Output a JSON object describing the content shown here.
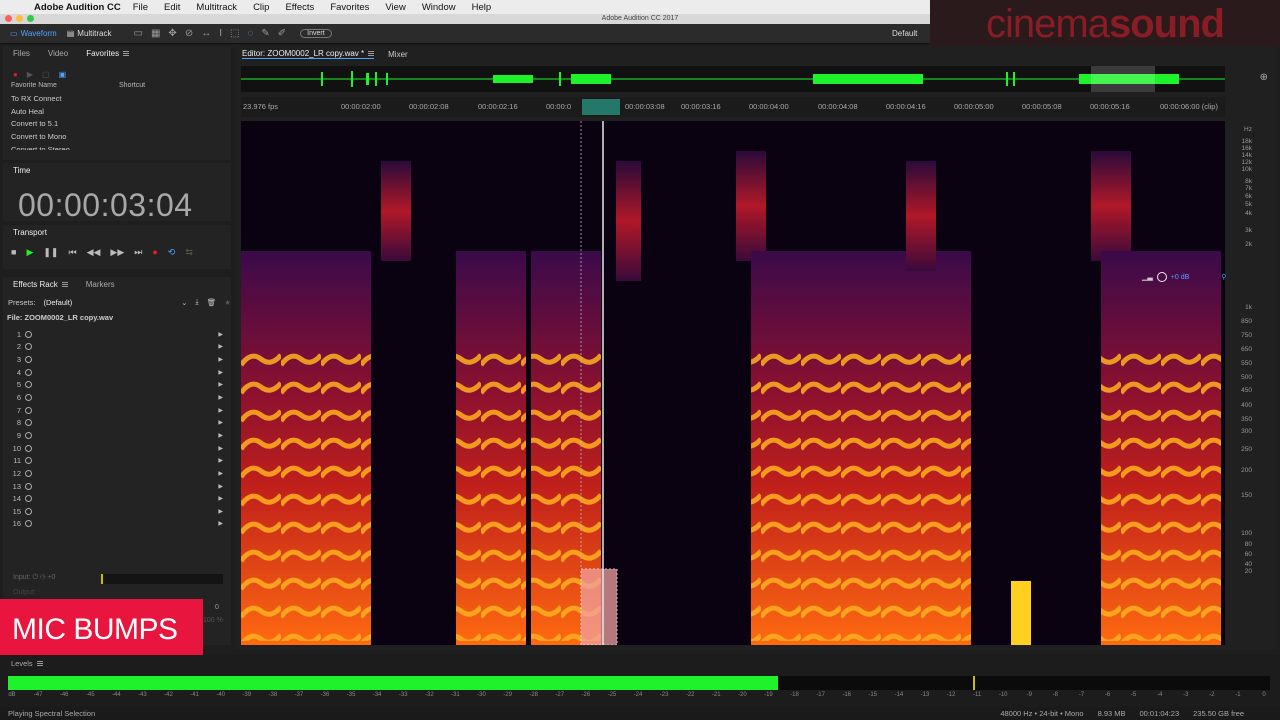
{
  "menubar": {
    "app_name": "Adobe Audition CC",
    "items": [
      "File",
      "Edit",
      "Multitrack",
      "Clip",
      "Effects",
      "Favorites",
      "View",
      "Window",
      "Help"
    ]
  },
  "window": {
    "title": "Adobe Audition CC 2017"
  },
  "toolbar": {
    "waveform_label": "Waveform",
    "multitrack_label": "Multitrack",
    "invert_label": "Invert",
    "workspace": "Default"
  },
  "brand": {
    "text_a": "cinema",
    "text_b": "sound"
  },
  "left_tabs": {
    "files": "Files",
    "video": "Video",
    "favorites": "Favorites"
  },
  "favorites": {
    "col_name": "Favorite Name",
    "col_shortcut": "Shortcut",
    "items": [
      "To RX Connect",
      "Auto Heal",
      "Convert to 5.1",
      "Convert to Mono",
      "Convert to Stereo"
    ]
  },
  "time_panel": {
    "title": "Time",
    "value": "00:00:03:04"
  },
  "transport": {
    "title": "Transport"
  },
  "effects_rack": {
    "tab_rack": "Effects Rack",
    "tab_markers": "Markers",
    "presets_label": "Presets:",
    "presets_value": "(Default)",
    "file_label": "File: ZOOM0002_LR copy.wav",
    "slots": [
      "1",
      "2",
      "3",
      "4",
      "5",
      "6",
      "7",
      "8",
      "9",
      "10",
      "11",
      "12",
      "13",
      "14",
      "15",
      "16"
    ],
    "input_label": "Input:",
    "output_label": "Output:",
    "db_value": "+0",
    "zero": "0",
    "pct": "100 %"
  },
  "overlay": {
    "label": "MIC BUMPS"
  },
  "editor": {
    "tab": "Editor: ZOOM0002_LR copy.wav *",
    "mixer": "Mixer",
    "fps": "23.976 fps",
    "ruler": [
      "00:00:02:00",
      "00:00:02:08",
      "00:00:02:16",
      "00:00:0",
      "00:00:03:08",
      "00:00:03:16",
      "00:00:04:00",
      "00:00:04:08",
      "00:00:04:16",
      "00:00:05:00",
      "00:00:05:08",
      "00:00:05:16",
      "00:00:06:00 (clip)"
    ],
    "hud_value": "+0 dB",
    "hz_labels": [
      "Hz",
      "18k",
      "16k",
      "14k",
      "12k",
      "10k",
      "8k",
      "7k",
      "6k",
      "5k",
      "4k",
      "3k",
      "2k",
      "1k",
      "850",
      "750",
      "650",
      "550",
      "500",
      "450",
      "400",
      "350",
      "300",
      "250",
      "200",
      "150",
      "100",
      "80",
      "60",
      "40",
      "20"
    ]
  },
  "levels": {
    "title": "Levels",
    "fill_fraction": 0.61,
    "peak_fraction": 0.765,
    "scale": [
      "dB",
      "-47",
      "-46",
      "-45",
      "-44",
      "-43",
      "-42",
      "-41",
      "-40",
      "-39",
      "-38",
      "-37",
      "-36",
      "-35",
      "-34",
      "-33",
      "-32",
      "-31",
      "-30",
      "-29",
      "-28",
      "-27",
      "-26",
      "-25",
      "-24",
      "-23",
      "-22",
      "-21",
      "-20",
      "-19",
      "-18",
      "-17",
      "-16",
      "-15",
      "-14",
      "-13",
      "-12",
      "-11",
      "-10",
      "-9",
      "-8",
      "-7",
      "-6",
      "-5",
      "-4",
      "-3",
      "-2",
      "-1",
      "0"
    ]
  },
  "status": {
    "left": "Playing Spectral Selection",
    "format": "48000 Hz • 24-bit • Mono",
    "size": "8.93 MB",
    "duration": "00:01:04:23",
    "free": "235.50 GB free"
  },
  "colors": {
    "accent": "#4fa3ff",
    "level_green": "#1ef22b",
    "overlay": "#e8163f",
    "brand": "#8a1c26"
  }
}
